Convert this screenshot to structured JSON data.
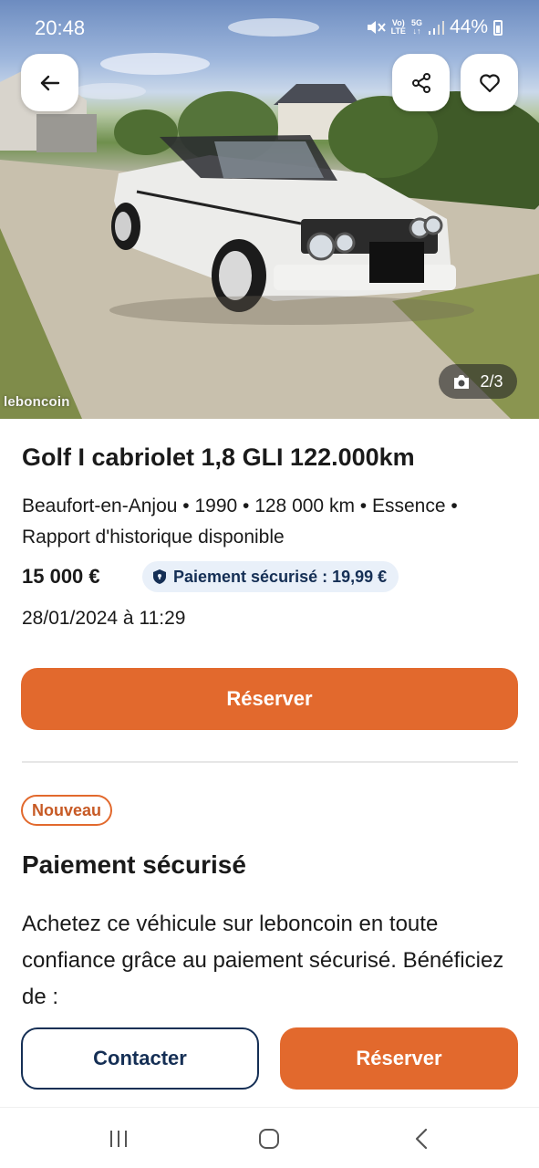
{
  "status_bar": {
    "time": "20:48",
    "network_top": "Vo)",
    "network_bottom": "LTE",
    "gen_top": "5G",
    "gen_bottom": "↓↑",
    "battery": "44%"
  },
  "hero": {
    "watermark": "leboncoin",
    "photo_counter": "2/3"
  },
  "listing": {
    "title": "Golf I cabriolet 1,8 GLI 122.000km",
    "meta": "Beaufort-en-Anjou • 1990 • 128 000 km • Essence • Rapport d'historique disponible",
    "price": "15 000 €",
    "secure_payment_badge": "Paiement sécurisé : 19,99 €",
    "date": "28/01/2024 à 11:29",
    "reserve_label": "Réserver"
  },
  "secure_section": {
    "badge": "Nouveau",
    "title": "Paiement sécurisé",
    "body": "Achetez ce véhicule sur leboncoin en toute confiance grâce au paiement sécurisé. Bénéficiez de :"
  },
  "bottom_bar": {
    "contact_label": "Contacter",
    "reserve_label": "Réserver"
  },
  "icons": {
    "back": "arrow-left-icon",
    "share": "share-icon",
    "favorite": "heart-icon",
    "camera": "camera-icon",
    "shield": "shield-icon"
  },
  "colors": {
    "accent_orange": "#e2692d",
    "navy": "#152f55",
    "badge_blue_bg": "#e9f0f9"
  }
}
